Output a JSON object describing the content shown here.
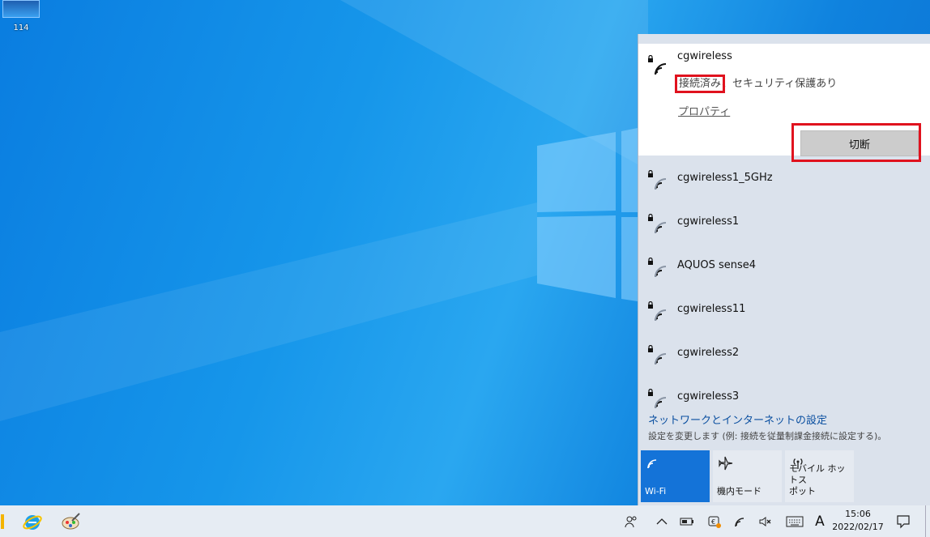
{
  "desktop": {
    "icon_label": "114"
  },
  "flyout": {
    "connected": {
      "ssid": "cgwireless",
      "status_highlight": "接続済み",
      "status_rest": "、セキュリティ保護あり",
      "properties_label": "プロパティ",
      "disconnect_label": "切断"
    },
    "networks": [
      {
        "ssid": "cgwireless1_5GHz"
      },
      {
        "ssid": "cgwireless1"
      },
      {
        "ssid": "AQUOS sense4"
      },
      {
        "ssid": "cgwireless11"
      },
      {
        "ssid": "cgwireless2"
      },
      {
        "ssid": "cgwireless3"
      }
    ],
    "settings_link": "ネットワークとインターネットの設定",
    "settings_desc": "設定を変更します (例: 接続を従量制課金接続に設定する)。",
    "quick_actions": [
      {
        "label": "Wi-Fi",
        "icon": "wifi-icon",
        "active": true
      },
      {
        "label": "機内モード",
        "icon": "airplane-icon",
        "active": false
      },
      {
        "label": "モバイル ホットス\nポット",
        "icon": "hotspot-icon",
        "active": false
      }
    ]
  },
  "taskbar": {
    "ime_label": "A",
    "time": "15:06",
    "date": "2022/02/17"
  },
  "colors": {
    "accent": "#1473d8",
    "highlight_red": "#e0121e",
    "flyout_bg": "#dbe2ec"
  }
}
